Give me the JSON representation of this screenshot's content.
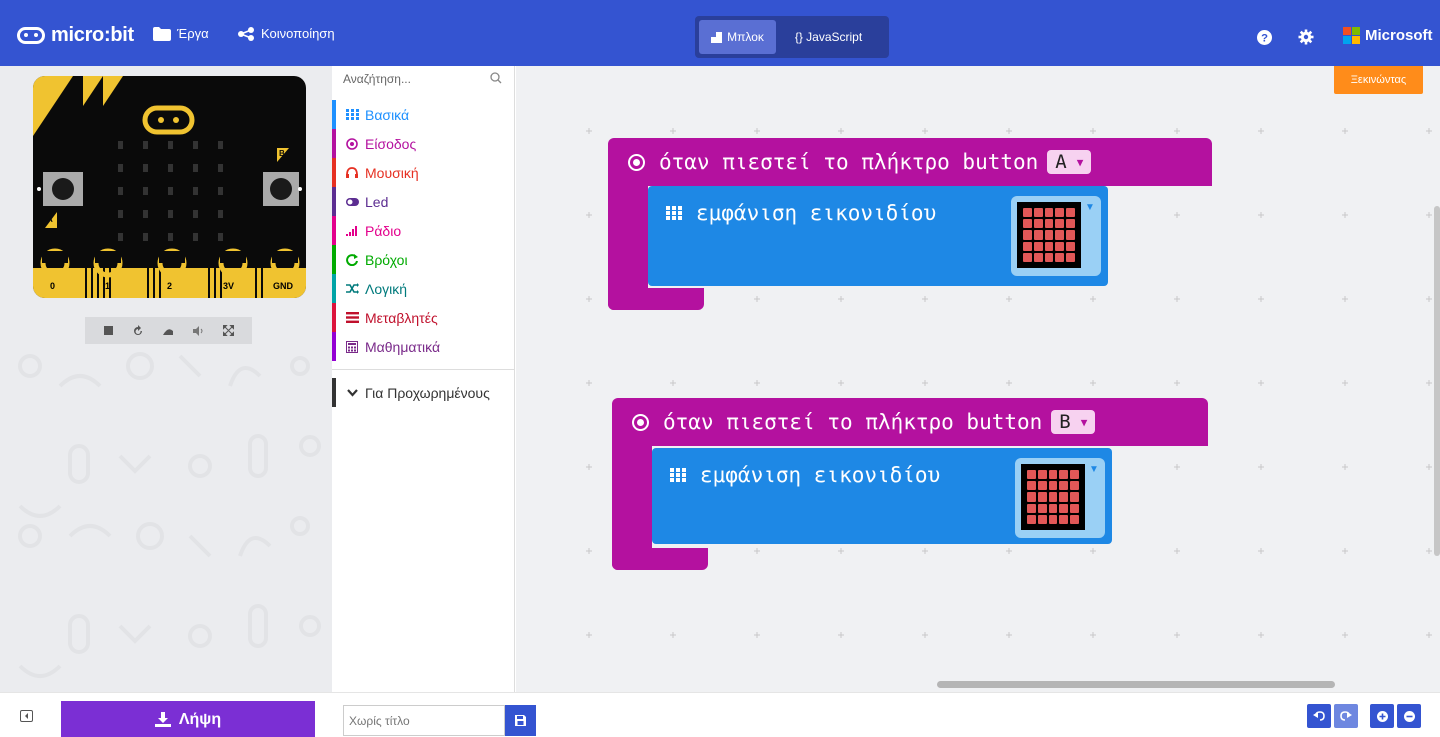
{
  "header": {
    "logo_text": "micro:bit",
    "projects_label": "Έργα",
    "share_label": "Κοινοποίηση",
    "blocks_label": "Μπλοκ",
    "javascript_label": "{} JavaScript",
    "microsoft_label": "Microsoft"
  },
  "simulator": {
    "pins": [
      "0",
      "1",
      "2",
      "3V",
      "GND"
    ],
    "button_a": "A",
    "button_b": "B"
  },
  "toolbox": {
    "search_placeholder": "Αναζήτηση...",
    "categories": [
      {
        "label": "Βασικά",
        "color": "#1e90ff",
        "icon": "grid-icon"
      },
      {
        "label": "Είσοδος",
        "color": "#b4119f",
        "icon": "target-icon"
      },
      {
        "label": "Μουσική",
        "color": "#e63022",
        "icon": "headphones-icon"
      },
      {
        "label": "Led",
        "color": "#5c2d91",
        "icon": "toggle-icon"
      },
      {
        "label": "Ράδιο",
        "color": "#e3008c",
        "icon": "signal-icon"
      },
      {
        "label": "Βρόχοι",
        "color": "#00aa00",
        "icon": "refresh-icon"
      },
      {
        "label": "Λογική",
        "color": "#00a4a6",
        "icon": "shuffle-icon"
      },
      {
        "label": "Μεταβλητές",
        "color": "#dc143c",
        "icon": "list-icon"
      },
      {
        "label": "Μαθηματικά",
        "color": "#9400d3",
        "icon": "calculator-icon"
      },
      {
        "label": "Για Προχωρημένους",
        "color": "#333333",
        "icon": "chevron-down-icon"
      }
    ]
  },
  "workspace": {
    "start_label": "Ξεκινώντας",
    "blocks": [
      {
        "event_text": "όταν πιεστεί το πλήκτρο button",
        "button": "A",
        "action_text": "εμφάνιση εικονιδίου"
      },
      {
        "event_text": "όταν πιεστεί το πλήκτρο button",
        "button": "B",
        "action_text": "εμφάνιση εικονιδίου"
      }
    ]
  },
  "footer": {
    "download_label": "Λήψη",
    "project_name_placeholder": "Χωρίς τίτλο"
  },
  "colors": {
    "header_blue": "#3454d1",
    "event_purple": "#b4119f",
    "basic_blue": "#1e88e5",
    "download_purple": "#7b2fd4",
    "start_orange": "#ff8c1a"
  }
}
